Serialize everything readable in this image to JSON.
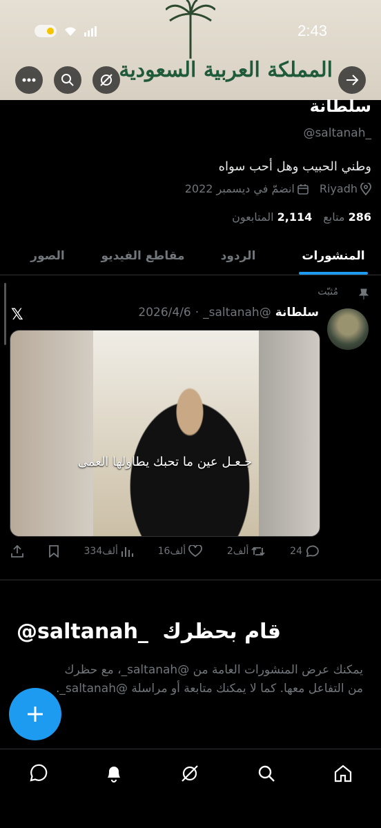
{
  "status_bar": {
    "time": "2:43"
  },
  "banner": {
    "title": "المملكة العربية السعودية"
  },
  "profile": {
    "name": "سلطانة",
    "handle": "@saltanah_",
    "bio": "وطني الحبيب وهل أحب سواه",
    "location": "Riyadh",
    "joined": "انضمّ في ديسمبر 2022",
    "following_count": "286",
    "following_label": "متابع",
    "followers_count": "2,114",
    "followers_label": "المتابعون"
  },
  "tabs": [
    {
      "label": "المنشورات",
      "active": true
    },
    {
      "label": "الردود",
      "active": false
    },
    {
      "label": "مقاطع الفيديو",
      "active": false
    },
    {
      "label": "الصور",
      "active": false
    }
  ],
  "post": {
    "pinned_label": "مُثبّت",
    "author": "سلطانة",
    "handle": "@saltanah_",
    "date": "2026/4/6",
    "media_caption": "جـعـل عين ما تحبك يطاولها العمى",
    "replies": "24",
    "reposts": "2ألف",
    "likes": "16ألف",
    "views": "334ألف"
  },
  "blocked": {
    "title": "قام بحظرك",
    "handle": "@saltanah_",
    "text": "يمكنك عرض المنشورات العامة من @saltanah_، مع حظرك من التفاعل معها. كما لا يمكنك متابعة أو مراسلة @saltanah_."
  },
  "icons": {
    "accent": "#1d9bf0"
  }
}
